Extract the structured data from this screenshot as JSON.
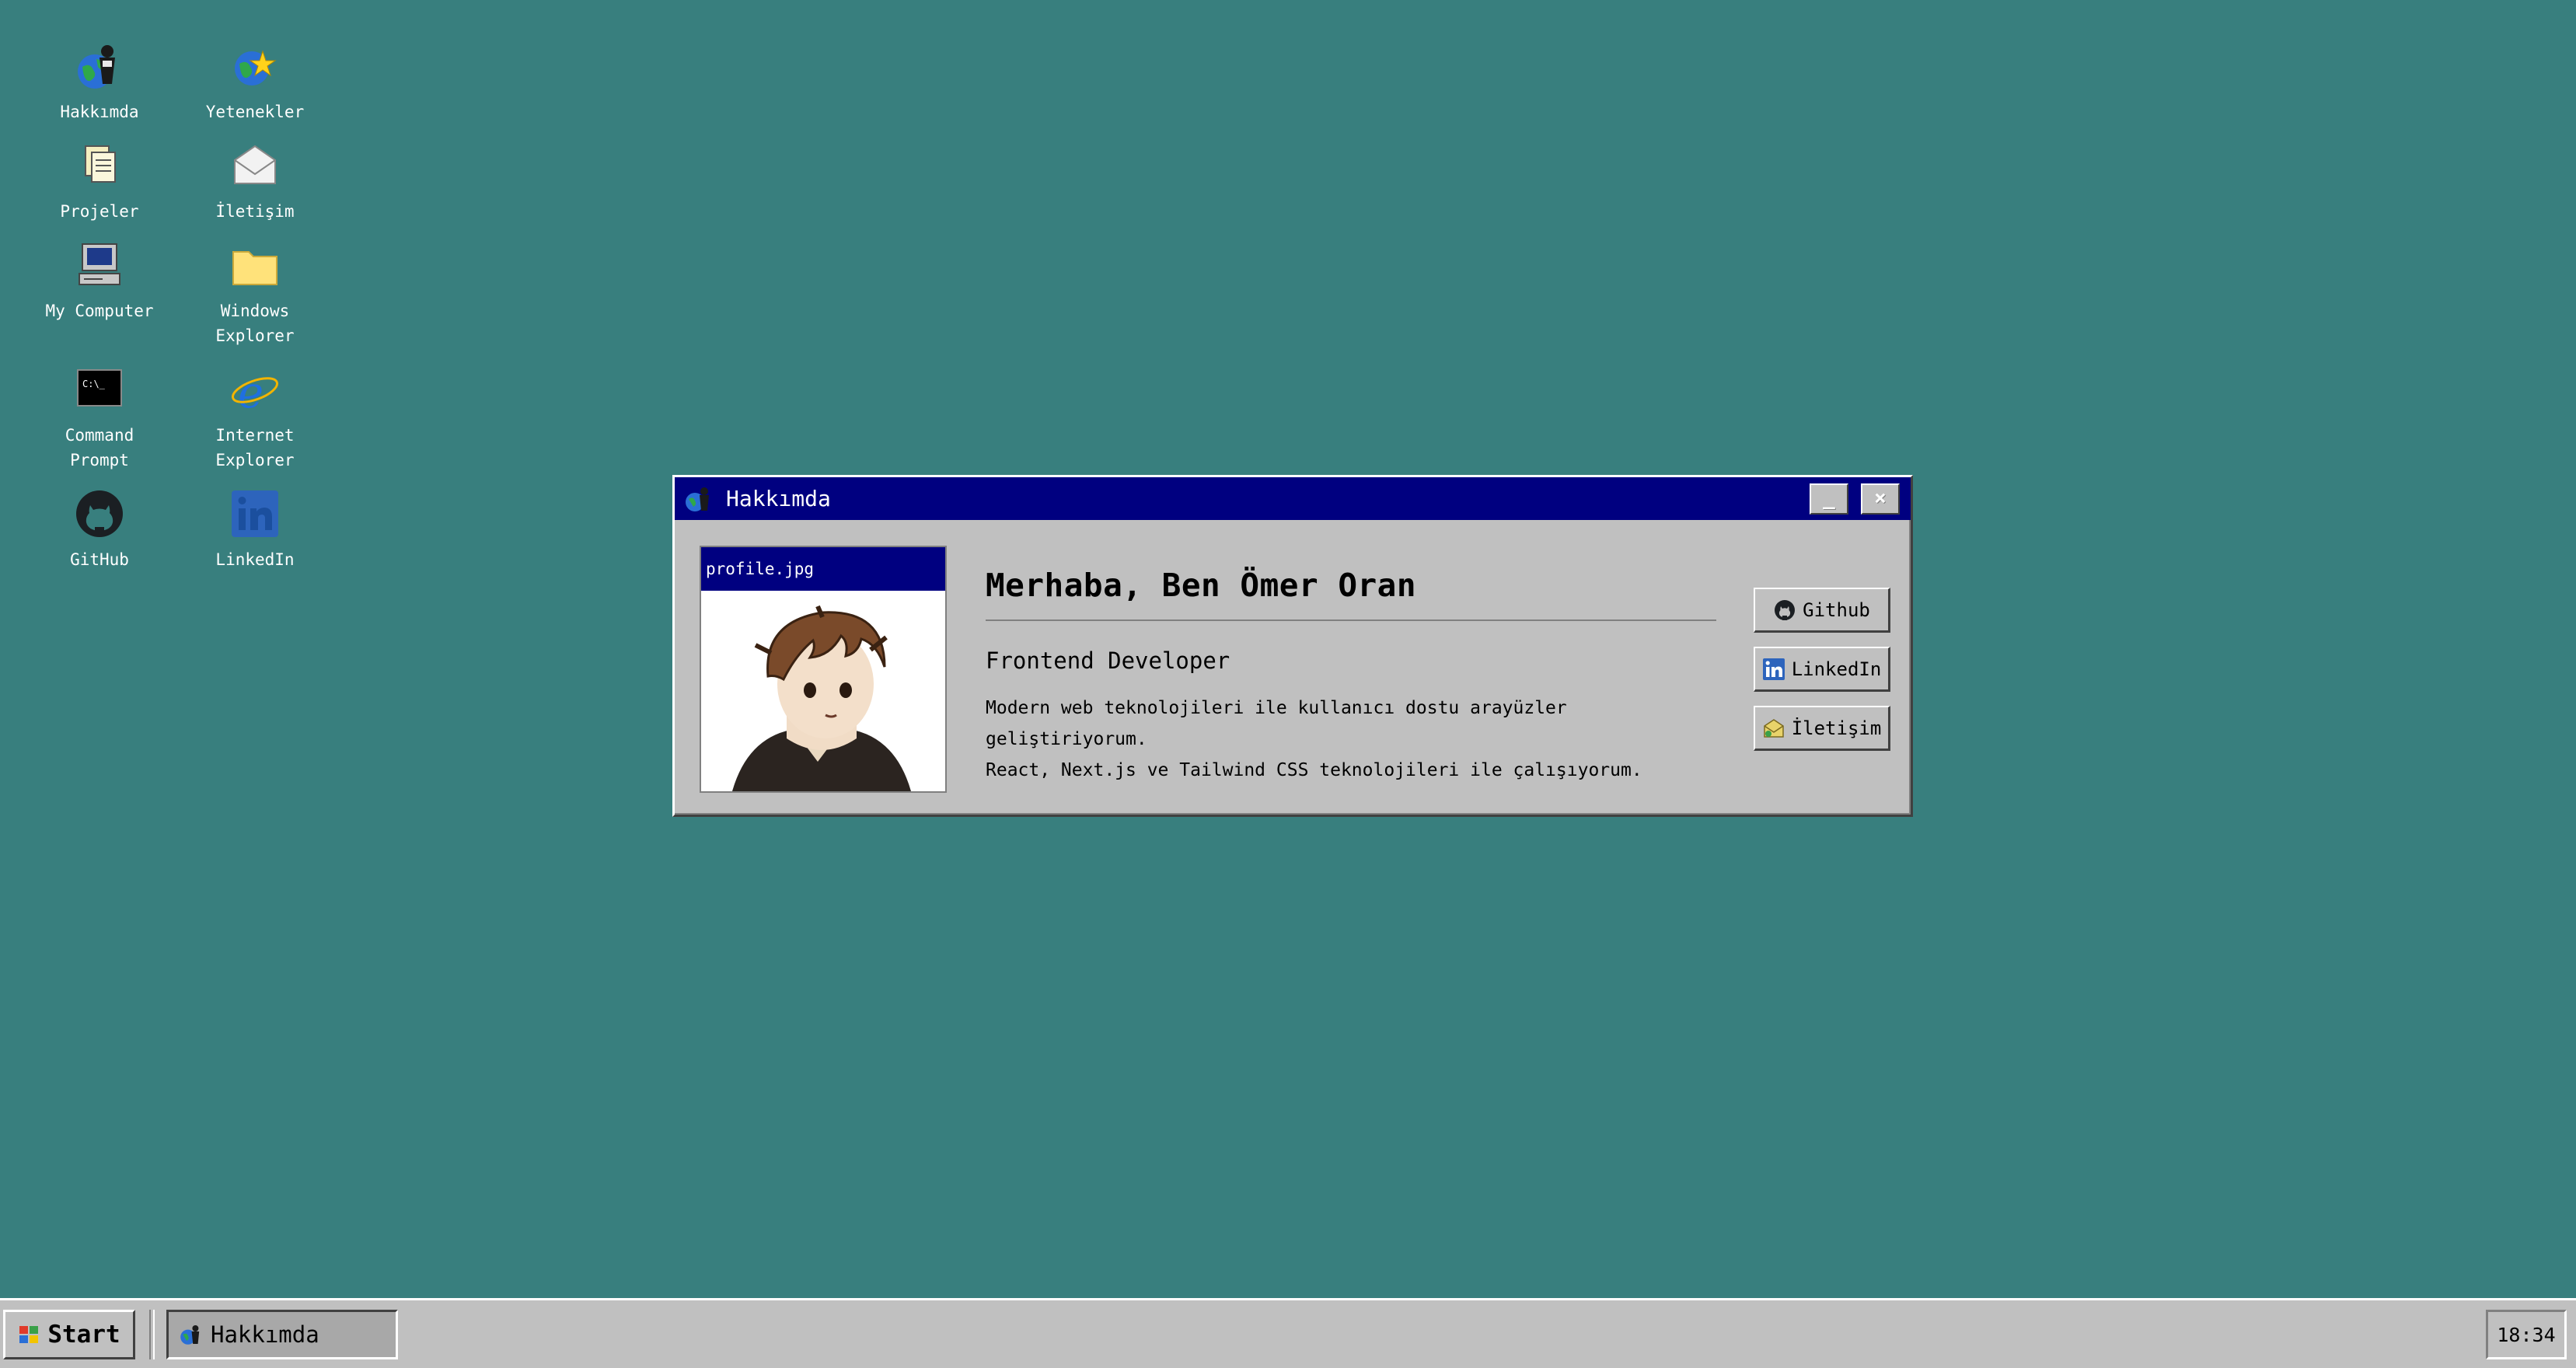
{
  "desktop": {
    "icons": [
      {
        "label": "Hakkımda",
        "icon": "globe-person-icon"
      },
      {
        "label": "Yetenekler",
        "icon": "globe-star-icon"
      },
      {
        "label": "Projeler",
        "icon": "documents-icon"
      },
      {
        "label": "İletişim",
        "icon": "envelope-icon"
      },
      {
        "label": "My Computer",
        "icon": "computer-icon"
      },
      {
        "label": "Windows\nExplorer",
        "icon": "folder-icon"
      },
      {
        "label": "Command\nPrompt",
        "icon": "command-prompt-icon"
      },
      {
        "label": "Internet\nExplorer",
        "icon": "internet-explorer-icon"
      },
      {
        "label": "GitHub",
        "icon": "github-icon"
      },
      {
        "label": "LinkedIn",
        "icon": "linkedin-icon"
      }
    ],
    "background_color": "#387f7e"
  },
  "window": {
    "title": "Hakkımda",
    "minimize_label": "_",
    "close_label": "×",
    "photo_title": "profile.jpg",
    "greeting": "Merhaba, Ben Ömer Oran",
    "role": "Frontend Developer",
    "description_line1": "Modern web teknolojileri ile kullanıcı dostu arayüzler geliştiriyorum.",
    "description_line2": "React, Next.js ve Tailwind CSS teknolojileri ile çalışıyorum.",
    "buttons": {
      "github": "Github",
      "linkedin": "LinkedIn",
      "contact": "İletişim"
    },
    "titlebar_color": "#000080"
  },
  "taskbar": {
    "start_label": "Start",
    "task_label": "Hakkımda",
    "clock": "18:34"
  }
}
